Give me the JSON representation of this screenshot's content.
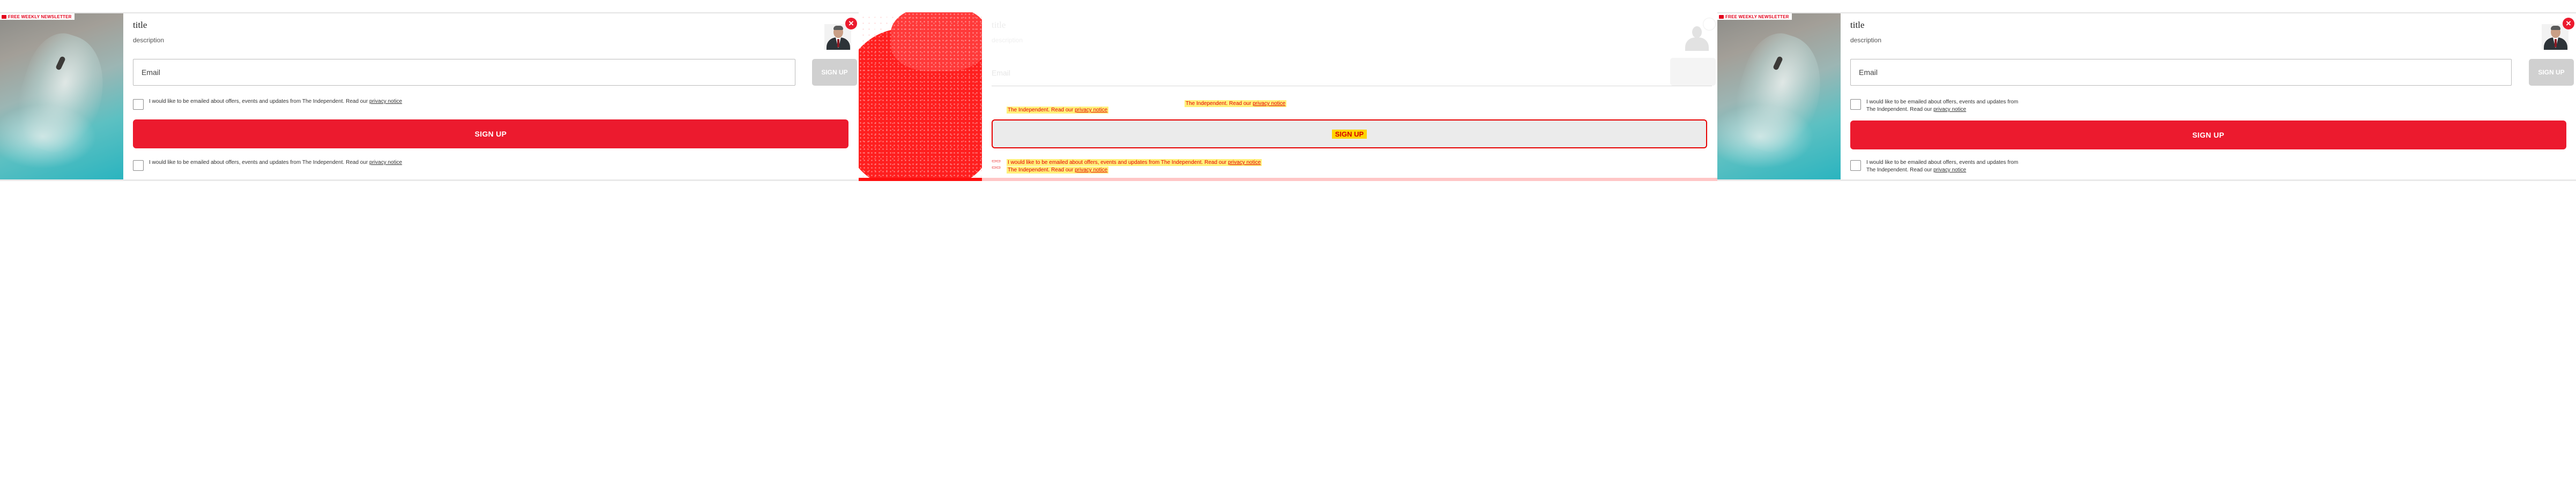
{
  "badge": "FREE WEEKLY NEWSLETTER",
  "popup": {
    "title": "title",
    "description": "description",
    "email_placeholder": "Email",
    "signup_small": "SIGN UP",
    "signup_main": "SIGN UP",
    "close_glyph": "×",
    "consent_text": "I would like to be emailed about offers, events and updates from The Independent. Read our",
    "consent_link": "privacy notice",
    "consent_line1": "I would like to be emailed about offers, events and updates from",
    "consent_line2": "The Independent. Read our"
  },
  "diff": {
    "button_label": "SIGN UP",
    "hl_line": "The Independent. Read our",
    "hl_full": "I would like to be emailed about offers, events and updates from The Independent. Read our",
    "link": "privacy notice"
  },
  "colors": {
    "accent": "#ec1a2e",
    "disabled_button": "#d0d0d0",
    "diff_red": "#ff1f1f",
    "diff_highlight": "#ffd400"
  },
  "icons": {
    "close": "close-icon",
    "mail": "mail-icon",
    "avatar": "author-avatar"
  }
}
